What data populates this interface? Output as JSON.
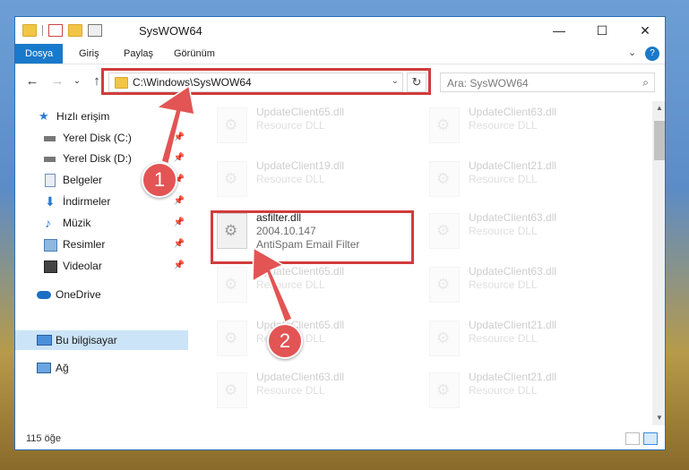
{
  "window": {
    "title": "SysWOW64"
  },
  "title_buttons": {
    "minimize": "—",
    "maximize": "☐",
    "close": "✕"
  },
  "ribbon": {
    "tabs": [
      "Dosya",
      "Giriş",
      "Paylaş",
      "Görünüm"
    ],
    "help": "?",
    "expand": "⌄"
  },
  "nav": {
    "back": "←",
    "forward": "→",
    "recent": "⌄",
    "up": "↑"
  },
  "address": {
    "path": "C:\\Windows\\SysWOW64",
    "dropdown": "⌄",
    "refresh": "↻"
  },
  "search": {
    "placeholder": "Ara: SysWOW64",
    "icon": "⌕"
  },
  "sidebar": {
    "items": [
      {
        "label": "Hızlı erişim",
        "icon": "star-icon",
        "pin": ""
      },
      {
        "label": "Yerel Disk (C:)",
        "icon": "drive-icon",
        "pin": "📌"
      },
      {
        "label": "Yerel Disk (D:)",
        "icon": "drive-icon",
        "pin": "📌"
      },
      {
        "label": "Belgeler",
        "icon": "document-icon",
        "pin": "📌"
      },
      {
        "label": "İndirmeler",
        "icon": "download-icon",
        "pin": "📌"
      },
      {
        "label": "Müzik",
        "icon": "music-icon",
        "pin": "📌"
      },
      {
        "label": "Resimler",
        "icon": "picture-icon",
        "pin": "📌"
      },
      {
        "label": "Videolar",
        "icon": "video-icon",
        "pin": "📌"
      },
      {
        "label": "OneDrive",
        "icon": "cloud-icon",
        "pin": ""
      },
      {
        "label": "Bu bilgisayar",
        "icon": "computer-icon",
        "pin": ""
      },
      {
        "label": "Ağ",
        "icon": "network-icon",
        "pin": ""
      }
    ]
  },
  "files": [
    {
      "name": "UpdateClient65.dll",
      "line2": "Resource DLL",
      "line3": ""
    },
    {
      "name": "UpdateClient63.dll",
      "line2": "Resource DLL",
      "line3": ""
    },
    {
      "name": "UpdateClient19.dll",
      "line2": "Resource DLL",
      "line3": ""
    },
    {
      "name": "UpdateClient21.dll",
      "line2": "Resource DLL",
      "line3": ""
    },
    {
      "name": "asfilter.dll",
      "line2": "2004.10.147",
      "line3": "AntiSpam Email Filter"
    },
    {
      "name": "UpdateClient63.dll",
      "line2": "Resource DLL",
      "line3": ""
    },
    {
      "name": "UpdateClient65.dll",
      "line2": "Resource DLL",
      "line3": ""
    },
    {
      "name": "UpdateClient63.dll",
      "line2": "Resource DLL",
      "line3": ""
    },
    {
      "name": "UpdateClient65.dll",
      "line2": "Resource DLL",
      "line3": ""
    },
    {
      "name": "UpdateClient21.dll",
      "line2": "Resource DLL",
      "line3": ""
    },
    {
      "name": "UpdateClient63.dll",
      "line2": "Resource DLL",
      "line3": ""
    },
    {
      "name": "UpdateClient21.dll",
      "line2": "Resource DLL",
      "line3": ""
    }
  ],
  "status": {
    "count": "115 öğe"
  },
  "annotations": {
    "badge1": "1",
    "badge2": "2"
  },
  "colors": {
    "accent": "#1979ca",
    "highlight_red": "#d23c3c",
    "badge_red": "#e35454",
    "selected_bg": "#cce4f7"
  }
}
